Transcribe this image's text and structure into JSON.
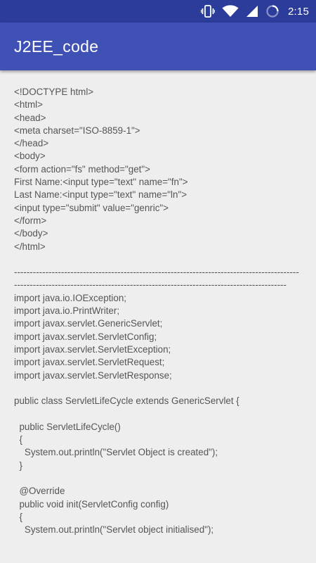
{
  "status_bar": {
    "time": "2:15",
    "icons": [
      "vibrate-icon",
      "wifi-icon",
      "cell-signal-icon",
      "loading-icon"
    ]
  },
  "app_bar": {
    "title": "J2EE_code"
  },
  "content": {
    "code": "<!DOCTYPE html>\n<html>\n<head>\n<meta charset=\"ISO-8859-1\">\n</head>\n<body>\n<form action=\"fs\" method=\"get\">\nFirst Name:<input type=\"text\" name=\"fn\">\nLast Name:<input type=\"text\" name=\"ln\">\n<input type=\"submit\" value=\"genric\">\n</form>\n</body>\n</html>\n\n----------------------------------------------------------------------------------------------------------------------------------------------------------------------------------\nimport java.io.IOException;\nimport java.io.PrintWriter;\nimport javax.servlet.GenericServlet;\nimport javax.servlet.ServletConfig;\nimport javax.servlet.ServletException;\nimport javax.servlet.ServletRequest;\nimport javax.servlet.ServletResponse;\n\npublic class ServletLifeCycle extends GenericServlet {\n\n  public ServletLifeCycle()\n  {\n    System.out.println(\"Servlet Object is created\");\n  }\n\n  @Override\n  public void init(ServletConfig config)\n  {\n    System.out.println(\"Servlet object initialised\");"
  },
  "colors": {
    "status_bar": "#2c3c9a",
    "app_bar": "#3f51b5",
    "background": "#eeeeee",
    "code_text": "#555555"
  }
}
